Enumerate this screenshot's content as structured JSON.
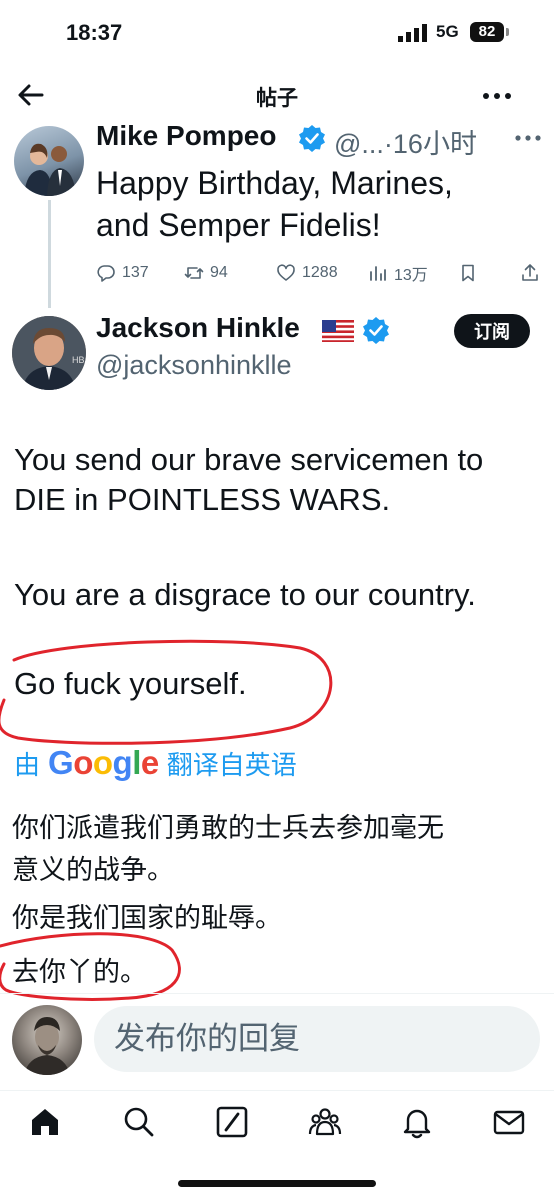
{
  "status_bar": {
    "time": "18:37",
    "network": "5G",
    "battery": "82"
  },
  "header": {
    "title": "帖子"
  },
  "parent_tweet": {
    "name": "Mike Pompeo",
    "handle": "@...",
    "time": "·16小时",
    "text_line1": "Happy Birthday, Marines,",
    "text_line2": "and Semper Fidelis!",
    "replies": "137",
    "retweets": "94",
    "likes": "1288",
    "views": "13万"
  },
  "main_tweet": {
    "name": "Jackson Hinkle",
    "handle": "@jacksonhinklle",
    "subscribe_label": "订阅",
    "para1_line1": "You send our brave servicemen to",
    "para1_line2": "DIE in POINTLESS WARS.",
    "para2": "You are a disgrace to our country.",
    "para3": "Go fuck yourself.",
    "translate_prefix": "由",
    "translate_brand": "Google",
    "translate_suffix": "翻译自英语",
    "cn_line1": "你们派遣我们勇敢的士兵去参加毫无",
    "cn_line2": "意义的战争。",
    "cn_line3": "你是我们国家的耻辱。",
    "cn_line4": "去你丫的。"
  },
  "reply": {
    "placeholder": "发布你的回复"
  },
  "colors": {
    "accent": "#1d9bf0",
    "annotation": "#e0242c",
    "muted": "#536471"
  },
  "icons": [
    "back-arrow-icon",
    "more-icon",
    "verified-icon",
    "us-flag-icon",
    "reply-icon",
    "retweet-icon",
    "like-icon",
    "views-icon",
    "bookmark-icon",
    "share-icon",
    "home-icon",
    "search-icon",
    "grok-icon",
    "communities-icon",
    "notifications-icon",
    "messages-icon"
  ]
}
